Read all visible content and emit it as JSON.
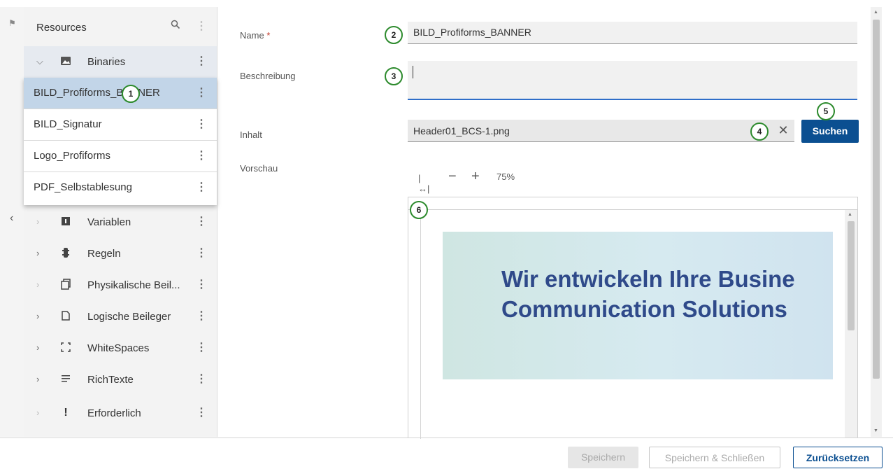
{
  "sidebar": {
    "title": "Resources",
    "items": [
      {
        "label": "Binaries",
        "icon": "image-icon",
        "expanded": true
      },
      {
        "label": "Variablen",
        "icon": "variable-icon"
      },
      {
        "label": "Regeln",
        "icon": "rules-icon"
      },
      {
        "label": "Physikalische Beil...",
        "icon": "physical-insert-icon"
      },
      {
        "label": "Logische Beileger",
        "icon": "logical-insert-icon"
      },
      {
        "label": "WhiteSpaces",
        "icon": "whitespace-icon"
      },
      {
        "label": "RichTexte",
        "icon": "richtext-icon"
      },
      {
        "label": "Erforderlich",
        "icon": "required-icon"
      }
    ],
    "binaries": [
      {
        "label": "BILD_Profiforms_BANNER",
        "selected": true
      },
      {
        "label": "BILD_Signatur"
      },
      {
        "label": "Logo_Profiforms"
      },
      {
        "label": "PDF_Selbstablesung"
      }
    ]
  },
  "markers": [
    "1",
    "2",
    "3",
    "4",
    "5",
    "6"
  ],
  "form": {
    "name_label": "Name",
    "required_mark": "*",
    "name_value": "BILD_Profiforms_BANNER",
    "description_label": "Beschreibung",
    "description_value": "",
    "content_label": "Inhalt",
    "content_value": "Header01_BCS-1.png",
    "search_button": "Suchen",
    "preview_label": "Vorschau"
  },
  "preview": {
    "zoom_level": "75%",
    "banner_line1": "Wir entwickeln Ihre Busine",
    "banner_line2": "Communication Solutions"
  },
  "footer": {
    "save": "Speichern",
    "save_close": "Speichern & Schließen",
    "reset": "Zurücksetzen"
  },
  "colors": {
    "primary": "#0b4f91",
    "selected_row": "#c2d5e8",
    "marker_ring": "#2c8a2c",
    "banner_text": "#2f4a8a"
  }
}
